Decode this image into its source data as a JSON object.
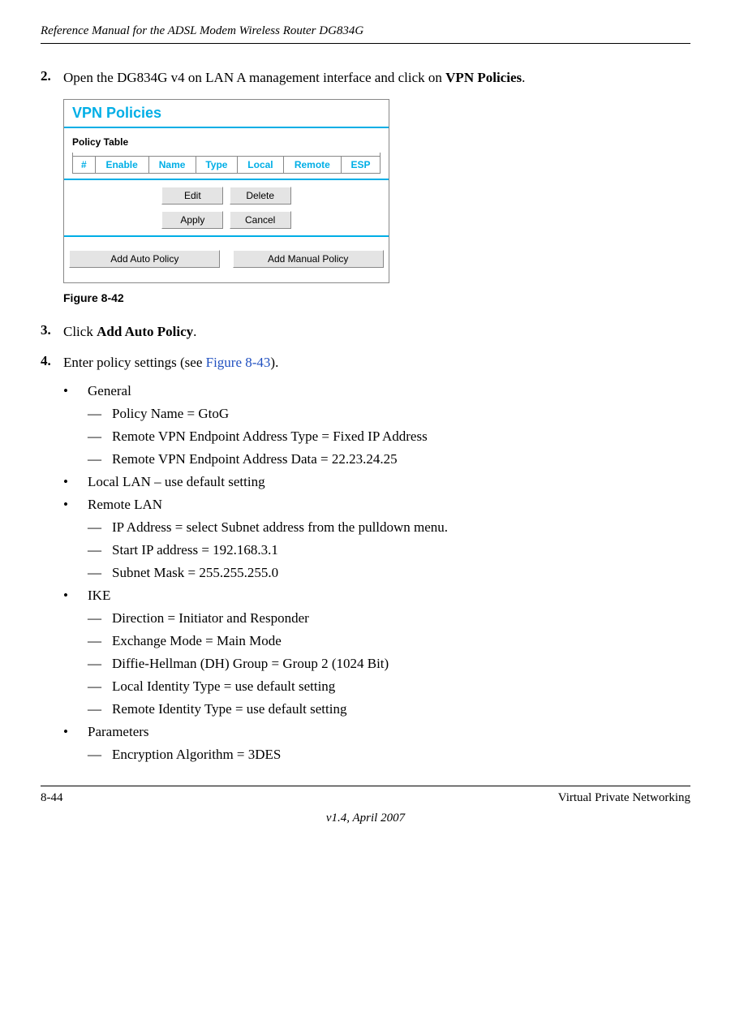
{
  "header": {
    "title": "Reference Manual for the ADSL Modem Wireless Router DG834G"
  },
  "steps": {
    "s2": {
      "num": "2.",
      "pre": "Open the DG834G v4 on LAN A management interface and click on ",
      "bold": "VPN Policies",
      "post": "."
    },
    "s3": {
      "num": "3.",
      "pre": "Click ",
      "bold": "Add Auto Policy",
      "post": "."
    },
    "s4": {
      "num": "4.",
      "pre": "Enter policy settings (see ",
      "link": "Figure 8-43",
      "post": ")."
    }
  },
  "figure": {
    "caption": "Figure 8-42",
    "panel": {
      "title": "VPN Policies",
      "subtitle": "Policy Table",
      "headers": [
        "#",
        "Enable",
        "Name",
        "Type",
        "Local",
        "Remote",
        "ESP"
      ],
      "buttons": {
        "edit": "Edit",
        "delete": "Delete",
        "apply": "Apply",
        "cancel": "Cancel",
        "add_auto": "Add Auto Policy",
        "add_manual": "Add Manual Policy"
      }
    }
  },
  "bullets": {
    "general": {
      "label": "General",
      "items": [
        "Policy Name = GtoG",
        "Remote VPN Endpoint Address Type = Fixed IP Address",
        "Remote VPN Endpoint Address Data = 22.23.24.25"
      ]
    },
    "local_lan": {
      "label": "Local LAN – use default setting"
    },
    "remote_lan": {
      "label": "Remote LAN",
      "items": [
        "IP Address = select Subnet address from the pulldown menu.",
        "Start IP address = 192.168.3.1",
        "Subnet Mask = 255.255.255.0"
      ]
    },
    "ike": {
      "label": "IKE",
      "items": [
        "Direction = Initiator and Responder",
        "Exchange Mode = Main Mode",
        "Diffie-Hellman (DH) Group = Group 2 (1024 Bit)",
        "Local Identity Type = use default setting",
        "Remote Identity Type = use default setting"
      ]
    },
    "parameters": {
      "label": "Parameters",
      "items": [
        "Encryption Algorithm = 3DES"
      ]
    }
  },
  "footer": {
    "left": "8-44",
    "right": "Virtual Private Networking",
    "center": "v1.4, April 2007"
  }
}
